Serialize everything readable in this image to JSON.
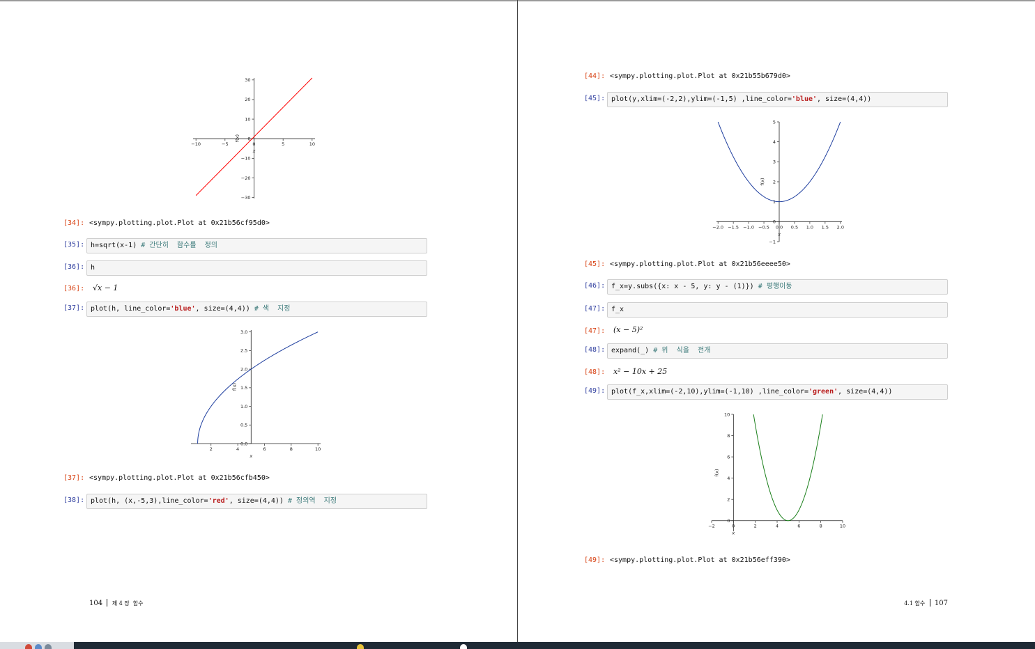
{
  "left_page": {
    "out34": {
      "prompt": "[34]:",
      "text": "<sympy.plotting.plot.Plot at 0x21b56cf95d0>"
    },
    "in35": {
      "prompt": "[35]:",
      "code": "h=sqrt(x-1) ",
      "comment": "# 간단히  함수를  정의"
    },
    "in36": {
      "prompt": "[36]:",
      "code": "h"
    },
    "out36": {
      "prompt": "[36]:",
      "math": "√x − 1"
    },
    "in37": {
      "prompt": "[37]:",
      "code_a": "plot(h, line_color=",
      "str": "'blue'",
      "code_b": ", size=(4,4)) ",
      "comment": "# 색  지정"
    },
    "out37": {
      "prompt": "[37]:",
      "text": "<sympy.plotting.plot.Plot at 0x21b56cfb450>"
    },
    "in38": {
      "prompt": "[38]:",
      "code_a": "plot(h, (x,-5,3),line_color=",
      "str": "'red'",
      "code_b": ", size=(4,4)) ",
      "comment": "# 정의역  지정"
    },
    "footer": {
      "page_number": "104",
      "chapter": "제 4 장  함수"
    }
  },
  "right_page": {
    "out44": {
      "prompt": "[44]:",
      "text": "<sympy.plotting.plot.Plot at 0x21b55b679d0>"
    },
    "in45": {
      "prompt": "[45]:",
      "code_a": "plot(y,xlim=(-2,2),ylim=(-1,5) ,line_color=",
      "str": "'blue'",
      "code_b": ", size=(4,4))"
    },
    "out45": {
      "prompt": "[45]:",
      "text": "<sympy.plotting.plot.Plot at 0x21b56eeee50>"
    },
    "in46": {
      "prompt": "[46]:",
      "code": "f_x=y.subs({x: x - 5, y: y - (1)}) ",
      "comment": "# 평행이동"
    },
    "in47": {
      "prompt": "[47]:",
      "code": "f_x"
    },
    "out47": {
      "prompt": "[47]:",
      "math": "(x − 5)²"
    },
    "in48": {
      "prompt": "[48]:",
      "code": "expand(_) ",
      "comment": "# 위  식을  전개"
    },
    "out48": {
      "prompt": "[48]:",
      "math": "x² − 10x + 25"
    },
    "in49": {
      "prompt": "[49]:",
      "code_a": "plot(f_x,xlim=(-2,10),ylim=(-1,10) ,line_color=",
      "str": "'green'",
      "code_b": ", size=(4,4))"
    },
    "out49": {
      "prompt": "[49]:",
      "text": "<sympy.plotting.plot.Plot at 0x21b56eff390>"
    },
    "footer": {
      "section": "4.1 함수",
      "page_number": "107"
    }
  },
  "chart_data": [
    {
      "type": "line",
      "function": "3x+1",
      "color": "#ff0000",
      "x": [
        -10,
        10
      ],
      "y": [
        -29,
        31
      ],
      "xlim": [
        -10,
        10
      ],
      "ylim": [
        -30,
        30
      ],
      "xticks": [
        "−10",
        "−5",
        "0",
        "5",
        "10"
      ],
      "yticks": [
        "−30",
        "−20",
        "−10",
        "0",
        "10",
        "20",
        "30"
      ],
      "xlabel": "x",
      "ylabel": "f(x)"
    },
    {
      "type": "line",
      "function": "sqrt(x-1)",
      "color": "#1f3f9f",
      "x": [
        1,
        1.1,
        1.3,
        1.6,
        2,
        2.5,
        3,
        4,
        5,
        6,
        7,
        8,
        9,
        10
      ],
      "y": [
        0,
        0.316,
        0.548,
        0.775,
        1.0,
        1.225,
        1.414,
        1.732,
        2.0,
        2.236,
        2.449,
        2.646,
        2.828,
        3.0
      ],
      "xlim": [
        1,
        10
      ],
      "ylim": [
        0,
        3
      ],
      "xticks": [
        "2",
        "4",
        "6",
        "8",
        "10"
      ],
      "yticks": [
        "0.0",
        "0.5",
        "1.0",
        "1.5",
        "2.0",
        "2.5",
        "3.0"
      ],
      "xlabel": "x",
      "ylabel": "f(x)"
    },
    {
      "type": "line",
      "function": "x^2+1",
      "color": "#1f3f9f",
      "x": [
        -2,
        -1.5,
        -1,
        -0.5,
        0,
        0.5,
        1,
        1.5,
        2
      ],
      "y": [
        5,
        3.25,
        2,
        1.25,
        1,
        1.25,
        2,
        3.25,
        5
      ],
      "xlim": [
        -2,
        2
      ],
      "ylim": [
        -1,
        5
      ],
      "xticks": [
        "−2.0",
        "−1.5",
        "−1.0",
        "−0.5",
        "0.0",
        "0.5",
        "1.0",
        "1.5",
        "2.0"
      ],
      "yticks": [
        "−1",
        "0",
        "1",
        "2",
        "3",
        "4",
        "5"
      ],
      "xlabel": "x",
      "ylabel": "f(x)"
    },
    {
      "type": "line",
      "function": "(x-5)^2",
      "color": "#1a7f1a",
      "x": [
        1.84,
        2,
        3,
        4,
        5,
        6,
        7,
        8,
        8.16
      ],
      "y": [
        10,
        9,
        4,
        1,
        0,
        1,
        4,
        9,
        10
      ],
      "xlim": [
        -2,
        10
      ],
      "ylim": [
        -1,
        10
      ],
      "xticks": [
        "−2",
        "0",
        "2",
        "4",
        "6",
        "8",
        "10"
      ],
      "yticks": [
        "0",
        "2",
        "4",
        "6",
        "8",
        "10"
      ],
      "xlabel": "x",
      "ylabel": "f(x)"
    }
  ]
}
